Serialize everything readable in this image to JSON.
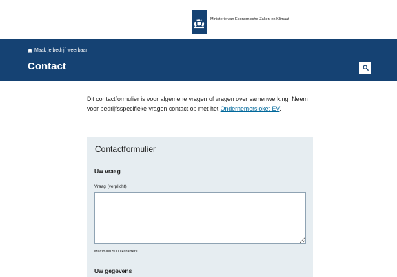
{
  "header": {
    "ministry_name": "Ministerie van Economische Zaken en Klimaat",
    "logo_icon": "coat-of-arms-icon"
  },
  "hero": {
    "breadcrumb_icon": "home-icon",
    "breadcrumb_label": "Maak je bedrijf weerbaar",
    "title": "Contact",
    "search_icon": "search-icon",
    "background_color": "#154273"
  },
  "intro": {
    "text_before_link": "Dit contactformulier is voor algemene vragen of vragen over samenwerking. Neem voor bedrijfsspecifieke vragen contact op met het ",
    "link_label": "Ondernemersloket EV",
    "text_after_link": "."
  },
  "form": {
    "title": "Contactformulier",
    "question_section": {
      "heading": "Uw vraag",
      "field_label": "Vraag (verplicht)",
      "value": "",
      "hint": "Maximaal 5000 karakters."
    },
    "details_section": {
      "heading": "Uw gegevens"
    },
    "panel_color": "#e6edf1",
    "link_color": "#01689b"
  }
}
